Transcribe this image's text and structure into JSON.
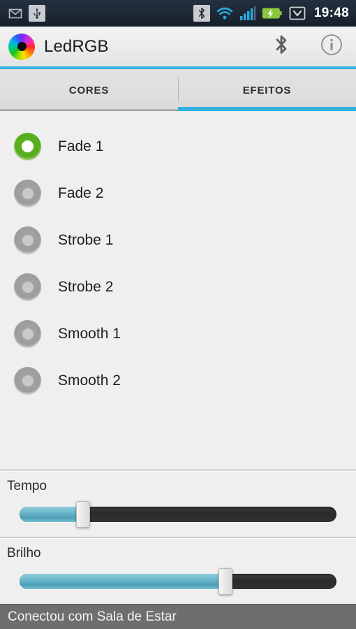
{
  "status_bar": {
    "time": "19:48",
    "left_icons": [
      {
        "name": "email-icon",
        "glyph": "envelope"
      },
      {
        "name": "usb-icon",
        "glyph": "usb"
      }
    ],
    "right_icons": [
      {
        "name": "bluetooth-status-icon",
        "glyph": "bluetooth"
      },
      {
        "name": "wifi-icon",
        "glyph": "wifi"
      },
      {
        "name": "cellular-signal-icon",
        "glyph": "signal-bars"
      },
      {
        "name": "battery-charging-icon",
        "glyph": "battery-bolt"
      },
      {
        "name": "alarm-checkmark-icon",
        "glyph": "battery-check"
      }
    ],
    "colors": {
      "background": "#1d2835",
      "accent_blue": "#29a8e0",
      "battery_green": "#8cc63f"
    }
  },
  "action_bar": {
    "logo_name": "color-wheel-logo",
    "title": "LedRGB",
    "actions": [
      {
        "name": "bluetooth-button",
        "label": "Bluetooth"
      },
      {
        "name": "info-button",
        "label": "Info"
      }
    ],
    "accent_color": "#32b0e0"
  },
  "tabs": {
    "items": [
      {
        "label": "CORES",
        "selected": false
      },
      {
        "label": "EFEITOS",
        "selected": true
      }
    ],
    "indicator_color": "#32b0e0"
  },
  "effects": {
    "selected_index": 0,
    "selected_color": "#56ad1d",
    "items": [
      {
        "label": "Fade 1"
      },
      {
        "label": "Fade 2"
      },
      {
        "label": "Strobe 1"
      },
      {
        "label": "Strobe 2"
      },
      {
        "label": "Smooth 1"
      },
      {
        "label": "Smooth 2"
      }
    ]
  },
  "sliders": [
    {
      "name": "tempo",
      "label": "Tempo",
      "value_percent": 20,
      "fill_color": "#4e9fb7"
    },
    {
      "name": "brilho",
      "label": "Brilho",
      "value_percent": 65,
      "fill_color": "#4e9fb7"
    }
  ],
  "bottom_status": {
    "message": "Conectou com Sala de Estar",
    "background": "#6e6e6e"
  }
}
